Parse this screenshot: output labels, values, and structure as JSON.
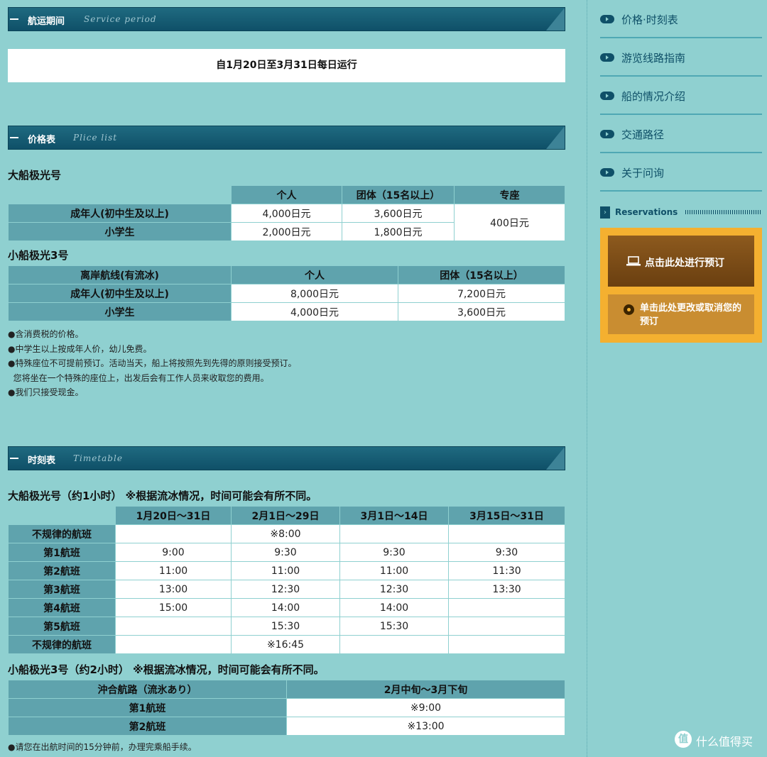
{
  "sections": {
    "service": {
      "title_cn": "航运期间",
      "title_en": "Service period"
    },
    "price": {
      "title_cn": "价格表",
      "title_en": "Plice list"
    },
    "timetable": {
      "title_cn": "时刻表",
      "title_en": "Timetable"
    }
  },
  "period_text": "自1月20日至3月31日每日运行",
  "big_ship_price": {
    "title": "大船极光号",
    "headers": [
      "个人",
      "团体（15名以上）",
      "专座"
    ],
    "rows": [
      {
        "label": "成年人(初中生及以上)",
        "individual": "4,000日元",
        "group": "3,600日元"
      },
      {
        "label": "小学生",
        "individual": "2,000日元",
        "group": "1,800日元"
      }
    ],
    "seat_price": "400日元"
  },
  "small_ship_price": {
    "title": "小船极光3号",
    "headers": [
      "离岸航线(有流冰)",
      "个人",
      "团体（15名以上）"
    ],
    "rows": [
      {
        "label": "成年人(初中生及以上)",
        "individual": "8,000日元",
        "group": "7,200日元"
      },
      {
        "label": "小学生",
        "individual": "4,000日元",
        "group": "3,600日元"
      }
    ]
  },
  "notes": [
    "●含消费税的价格。",
    "●中学生以上按成年人价，幼儿免费。",
    "●特殊座位不可提前预订。活动当天，船上将按照先到先得的原则接受预订。",
    "  您将坐在一个特殊的座位上，出发后会有工作人员来收取您的费用。",
    "●我们只接受现金。"
  ],
  "big_timetable": {
    "title": "大船极光号（约1小时） ※根据流冰情况，时间可能会有所不同。",
    "headers": [
      "1月20日～31日",
      "2月1日～29日",
      "3月1日～14日",
      "3月15日～31日"
    ],
    "rows": [
      {
        "label": "不规律的航班",
        "cells": [
          "",
          "※8:00",
          "",
          ""
        ]
      },
      {
        "label": "第1航班",
        "cells": [
          "9:00",
          "9:30",
          "9:30",
          "9:30"
        ]
      },
      {
        "label": "第2航班",
        "cells": [
          "11:00",
          "11:00",
          "11:00",
          "11:30"
        ]
      },
      {
        "label": "第3航班",
        "cells": [
          "13:00",
          "12:30",
          "12:30",
          "13:30"
        ]
      },
      {
        "label": "第4航班",
        "cells": [
          "15:00",
          "14:00",
          "14:00",
          ""
        ]
      },
      {
        "label": "第5航班",
        "cells": [
          "",
          "15:30",
          "15:30",
          ""
        ]
      },
      {
        "label": "不规律的航班",
        "cells": [
          "",
          "※16:45",
          "",
          ""
        ]
      }
    ]
  },
  "small_timetable": {
    "title": "小船极光3号（约2小时） ※根据流冰情况，时间可能会有所不同。",
    "headers": [
      "沖合航路（流氷あり）",
      "2月中旬～3月下旬"
    ],
    "rows": [
      {
        "label": "第1航班",
        "value": "※9:00"
      },
      {
        "label": "第2航班",
        "value": "※13:00"
      }
    ]
  },
  "footer_note": "●请您在出航时间的15分钟前，办理完乘船手续。",
  "sidebar": {
    "nav": [
      "价格·时刻表",
      "游览线路指南",
      "船的情况介绍",
      "交通路径",
      "关于问询"
    ],
    "reservations_title": "Reservations",
    "reserve_button": "点击此处进行预订",
    "change_button": "单击此处更改或取消您的预订"
  },
  "watermark": {
    "badge": "值",
    "text": "什么值得买"
  },
  "icons": [
    "arrow-pill-icon",
    "laptop-icon",
    "dot-icon",
    "chevron-right-icon"
  ]
}
